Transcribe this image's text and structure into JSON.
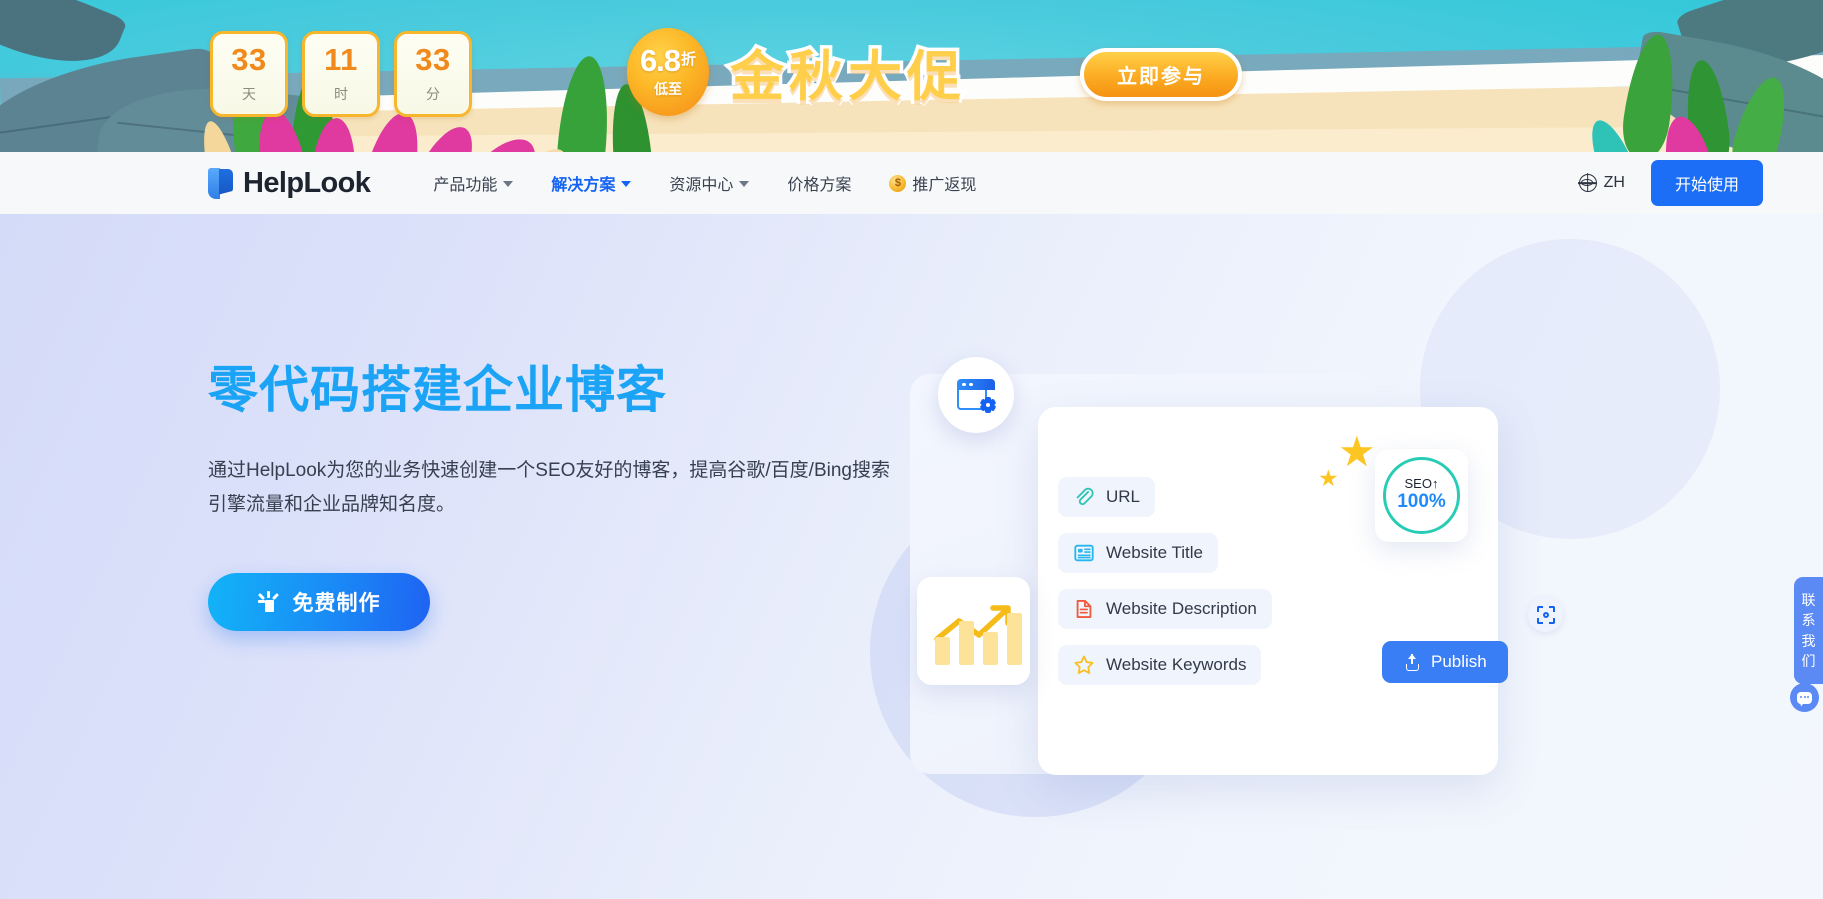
{
  "promo": {
    "countdown": [
      {
        "value": "33",
        "unit": "天"
      },
      {
        "value": "11",
        "unit": "时"
      },
      {
        "value": "33",
        "unit": "分"
      }
    ],
    "discount_value": "6.8",
    "discount_suffix": "折",
    "discount_sub": "低至",
    "title": "金秋大促",
    "cta_label": "立即参与",
    "accent_color": "#f7a81b"
  },
  "nav": {
    "brand": "HelpLook",
    "links": [
      {
        "label": "产品功能",
        "has_caret": true,
        "active": false
      },
      {
        "label": "解决方案",
        "has_caret": true,
        "active": true
      },
      {
        "label": "资源中心",
        "has_caret": true,
        "active": false
      },
      {
        "label": "价格方案",
        "has_caret": false,
        "active": false
      },
      {
        "label": "推广返现",
        "has_caret": false,
        "active": false,
        "icon": "coin-icon"
      }
    ],
    "coin_glyph": "$",
    "language": "ZH",
    "start_button": "开始使用",
    "active_color": "#1463f3",
    "button_color": "#1b6ef5"
  },
  "hero": {
    "title": "零代码搭建企业博客",
    "description": "通过HelpLook为您的业务快速创建一个SEO友好的博客，提高谷歌/百度/Bing搜索引擎流量和企业品牌知名度。",
    "cta_label": "免费制作",
    "title_color": "#1ba4f5"
  },
  "illustration": {
    "fields": [
      {
        "label": "URL",
        "icon": "paperclip-icon",
        "color": "#2ec5b6"
      },
      {
        "label": "Website Title",
        "icon": "article-icon",
        "color": "#27b6f0"
      },
      {
        "label": "Website Description",
        "icon": "document-icon",
        "color": "#f05a3c"
      },
      {
        "label": "Website Keywords",
        "icon": "star-icon",
        "color": "#f7c023"
      }
    ],
    "publish_label": "Publish",
    "seo_label": "SEO↑",
    "seo_value": "100%",
    "seo_ring_color": "#28ccb5"
  },
  "widgets": {
    "contact_label": "联系我们"
  }
}
